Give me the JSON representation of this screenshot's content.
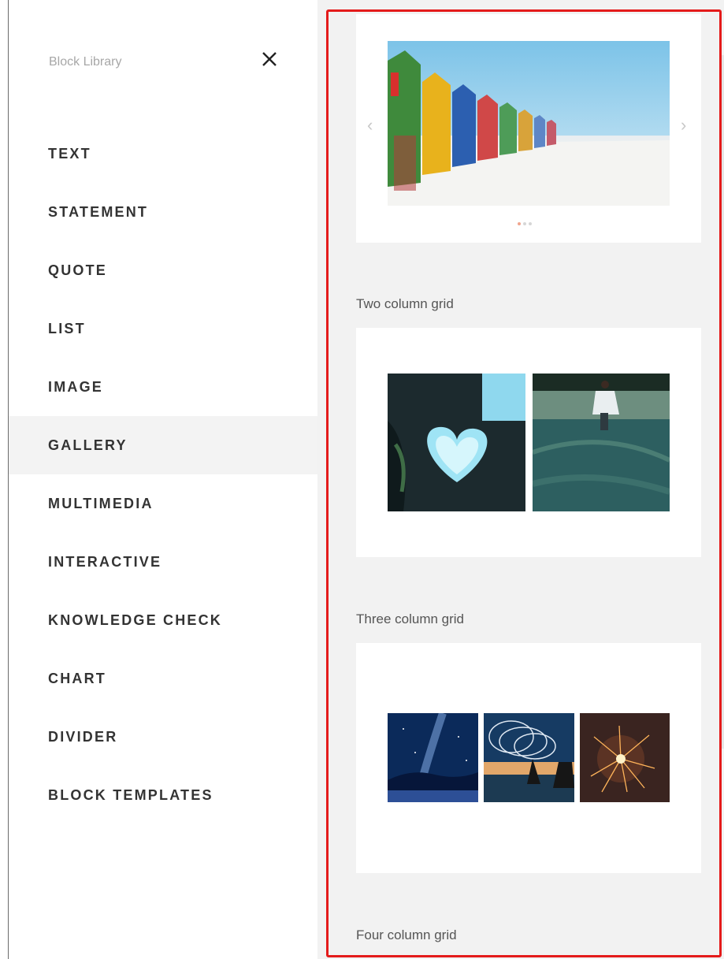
{
  "sidebar": {
    "title": "Block Library",
    "close_icon": "close-icon",
    "items": [
      {
        "label": "TEXT"
      },
      {
        "label": "STATEMENT"
      },
      {
        "label": "QUOTE"
      },
      {
        "label": "LIST"
      },
      {
        "label": "IMAGE"
      },
      {
        "label": "GALLERY",
        "active": true
      },
      {
        "label": "MULTIMEDIA"
      },
      {
        "label": "INTERACTIVE"
      },
      {
        "label": "KNOWLEDGE CHECK"
      },
      {
        "label": "CHART"
      },
      {
        "label": "DIVIDER"
      },
      {
        "label": "BLOCK TEMPLATES"
      }
    ]
  },
  "gallery": {
    "carousel": {
      "prev_icon": "chevron-left-icon",
      "next_icon": "chevron-right-icon",
      "current_slide": 1,
      "slide_count": 3
    },
    "sections": [
      {
        "label": "Two column grid"
      },
      {
        "label": "Three column grid"
      },
      {
        "label": "Four column grid"
      }
    ]
  },
  "colors": {
    "highlight": "#e41b1b",
    "active_item_bg": "#f3f3f3",
    "panel_bg": "#f2f2f2",
    "dot_active": "#f0a58d"
  }
}
